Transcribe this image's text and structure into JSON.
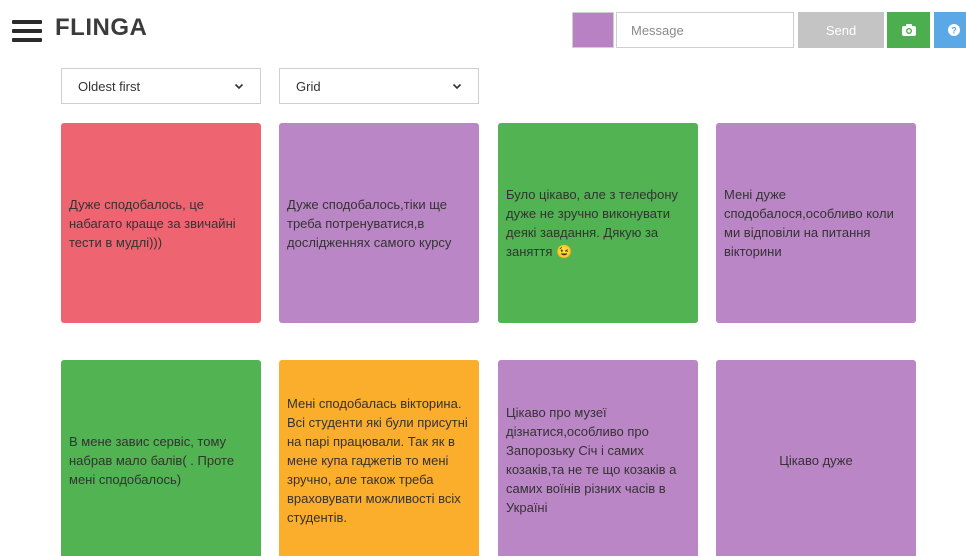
{
  "header": {
    "logo": "FLINGA",
    "message_placeholder": "Message",
    "send_label": "Send",
    "swatch_color": "#b881c4"
  },
  "filters": {
    "sort": "Oldest first",
    "view": "Grid"
  },
  "colors": {
    "red": "#ee6470",
    "purple": "#bb86c6",
    "green": "#51b351",
    "orange": "#fbae2c"
  },
  "cards": [
    {
      "color": "red",
      "text": "Дуже сподобалось, це набагато краще за звичайні тести в мудлі)))"
    },
    {
      "color": "purple",
      "text": "Дуже сподобалось,тіки ще треба потренуватися,в дослідженнях самого курсу"
    },
    {
      "color": "green",
      "text": "Було цікаво, але з телефону дуже не зручно виконувати деякі завдання. Дякую за заняття 😉"
    },
    {
      "color": "purple",
      "text": "Мені дуже сподобалося,особливо коли ми відповіли на питання вікторини"
    },
    {
      "color": "green",
      "text": "В мене завис сервіс, тому набрав мало балів( . Проте мені сподобалось)"
    },
    {
      "color": "orange",
      "text": "Мені сподобалась вікторина. Всі студенти які були присутні на парі працювали. Так як в мене купа гаджетів то мені зручно, але також треба враховувати можливості всіх студентів."
    },
    {
      "color": "purple",
      "text": "Цікаво про музеї дізнатися,особливо про Запорозьку Січ і самих козаків,та не те що козаків а самих воїнів різних часів в Україні"
    },
    {
      "color": "purple",
      "text": "Цікаво дуже"
    }
  ]
}
